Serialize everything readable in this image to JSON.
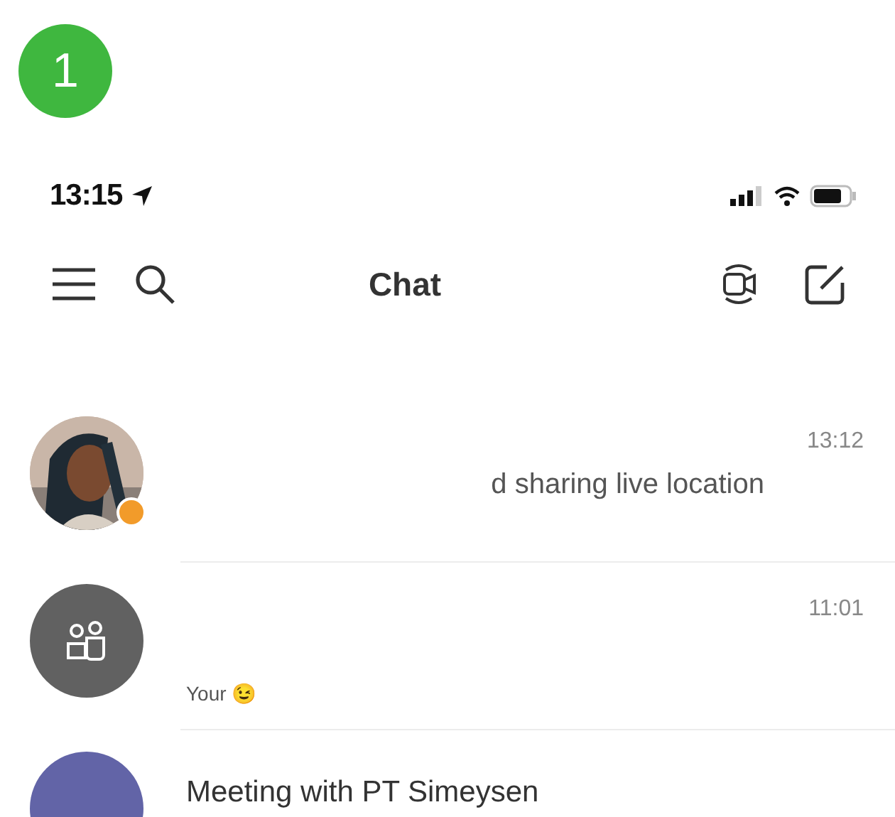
{
  "step_badge": "1",
  "status_bar": {
    "time": "13:15"
  },
  "nav": {
    "title": "Chat"
  },
  "chats": [
    {
      "kind": "person",
      "time": "13:12",
      "preview": "d sharing live location",
      "away": true
    },
    {
      "kind": "group",
      "time": "11:01",
      "preview": "Your 😉",
      "away": false
    },
    {
      "kind": "meeting",
      "title": "Meeting with PT Simeysen",
      "away": false
    }
  ]
}
